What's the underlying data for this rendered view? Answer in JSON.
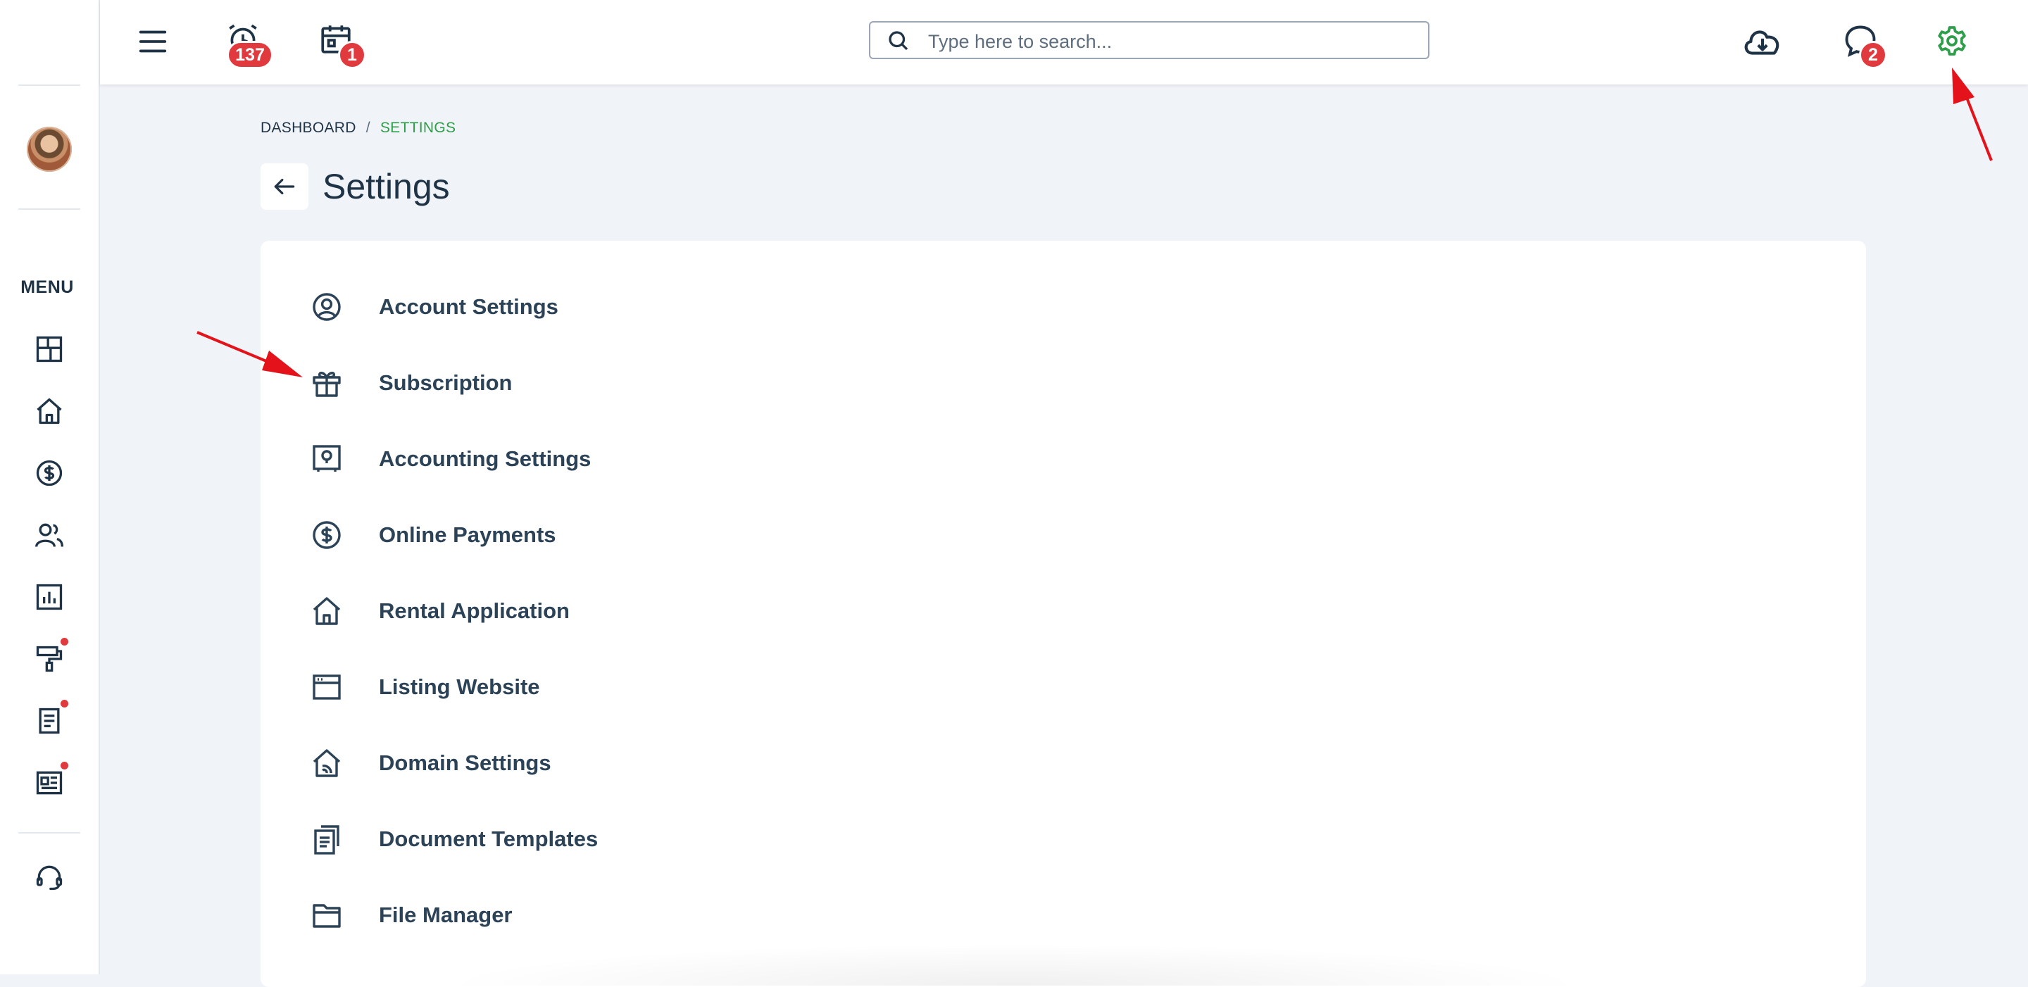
{
  "topbar": {
    "alarm_badge": "137",
    "calendar_badge": "1",
    "messages_badge": "2",
    "search_placeholder": "Type here to search..."
  },
  "sidebar": {
    "menu_label": "MENU",
    "items": [
      {
        "icon": "dashboard-icon",
        "has_dot": false
      },
      {
        "icon": "home-icon",
        "has_dot": false
      },
      {
        "icon": "dollar-icon",
        "has_dot": false
      },
      {
        "icon": "people-icon",
        "has_dot": false
      },
      {
        "icon": "report-chart-icon",
        "has_dot": false
      },
      {
        "icon": "paint-roller-icon",
        "has_dot": true
      },
      {
        "icon": "document-icon",
        "has_dot": true
      },
      {
        "icon": "news-card-icon",
        "has_dot": true
      }
    ],
    "support_icon": "headset-icon"
  },
  "breadcrumb": {
    "home": "DASHBOARD",
    "separator": "/",
    "current": "SETTINGS"
  },
  "page": {
    "title": "Settings"
  },
  "settings": [
    {
      "label": "Account Settings",
      "icon": "user-circle-icon"
    },
    {
      "label": "Subscription",
      "icon": "gift-icon"
    },
    {
      "label": "Accounting Settings",
      "icon": "safe-icon"
    },
    {
      "label": "Online Payments",
      "icon": "dollar-circle-icon"
    },
    {
      "label": "Rental Application",
      "icon": "house-icon"
    },
    {
      "label": "Listing Website",
      "icon": "browser-window-icon"
    },
    {
      "label": "Domain Settings",
      "icon": "house-wifi-icon"
    },
    {
      "label": "Document Templates",
      "icon": "documents-icon"
    },
    {
      "label": "File Manager",
      "icon": "folder-icon"
    }
  ],
  "colors": {
    "accent_green": "#2e9e4a",
    "badge_red": "#e0393e",
    "annotation_red": "#e3121b",
    "text_dark": "#1f3347",
    "background": "#f0f3f7"
  }
}
